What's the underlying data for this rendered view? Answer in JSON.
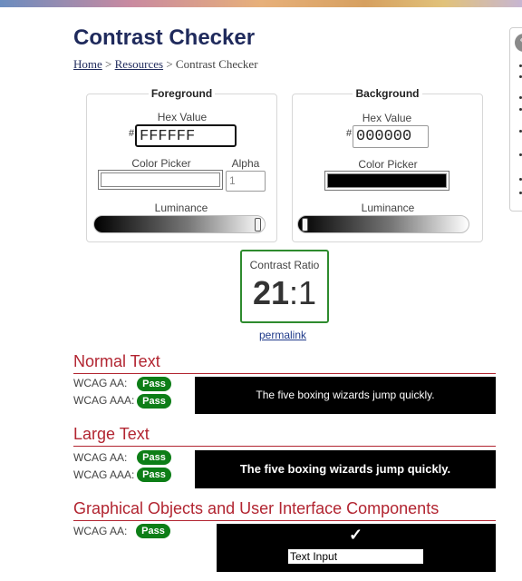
{
  "header": {
    "title": "Contrast Checker",
    "breadcrumb": {
      "home": "Home",
      "sep1": " > ",
      "resources": "Resources",
      "sep2": " > ",
      "current": "Contrast Checker"
    }
  },
  "foreground": {
    "legend": "Foreground",
    "hex_label": "Hex Value",
    "hash": "#",
    "hex_value": "FFFFFF",
    "color_picker_label": "Color Picker",
    "alpha_label": "Alpha",
    "alpha_placeholder": "1",
    "luminance_label": "Luminance",
    "swatch_color": "#ffffff",
    "luminance_level": 1.0
  },
  "background": {
    "legend": "Background",
    "hex_label": "Hex Value",
    "hash": "#",
    "hex_value": "000000",
    "color_picker_label": "Color Picker",
    "luminance_label": "Luminance",
    "swatch_color": "#000000",
    "luminance_level": 0.0
  },
  "ratio": {
    "label": "Contrast Ratio",
    "major": "21",
    "minor": ":1",
    "permalink": "permalink"
  },
  "normal_text": {
    "heading": "Normal Text",
    "aa_label": "WCAG AA:",
    "aa_result": "Pass",
    "aaa_label": "WCAG AAA:",
    "aaa_result": "Pass",
    "sample": "The five boxing wizards jump quickly."
  },
  "large_text": {
    "heading": "Large Text",
    "aa_label": "WCAG AA:",
    "aa_result": "Pass",
    "aaa_label": "WCAG AAA:",
    "aaa_result": "Pass",
    "sample": "The five boxing wizards jump quickly."
  },
  "graphical": {
    "heading": "Graphical Objects and User Interface Components",
    "aa_label": "WCAG AA:",
    "aa_result": "Pass",
    "check": "✓",
    "input_text": "Text Input"
  },
  "colors": {
    "accent_red": "#b22531",
    "pass_green": "#0d7e17",
    "title_navy": "#1f2a5c"
  }
}
